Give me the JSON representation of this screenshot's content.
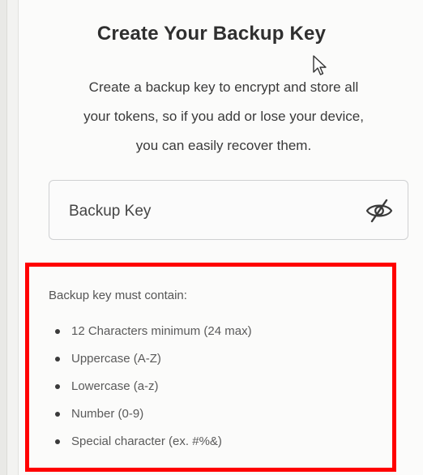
{
  "header": {
    "title": "Create Your Backup Key"
  },
  "description": {
    "line1": "Create a backup key to encrypt and store all",
    "line2": "your tokens, so if you add or lose your device,",
    "line3": "you can easily recover them."
  },
  "backup_key_field": {
    "placeholder": "Backup Key",
    "value": "",
    "visibility_icon": "eye-slash-icon"
  },
  "requirements": {
    "heading": "Backup key must contain:",
    "items": [
      "12 Characters minimum (24 max)",
      "Uppercase (A-Z)",
      "Lowercase (a-z)",
      "Number (0-9)",
      "Special character (ex. #%&)"
    ],
    "highlight_color": "#ff0000"
  },
  "cursor_icon": "mouse-pointer-icon"
}
